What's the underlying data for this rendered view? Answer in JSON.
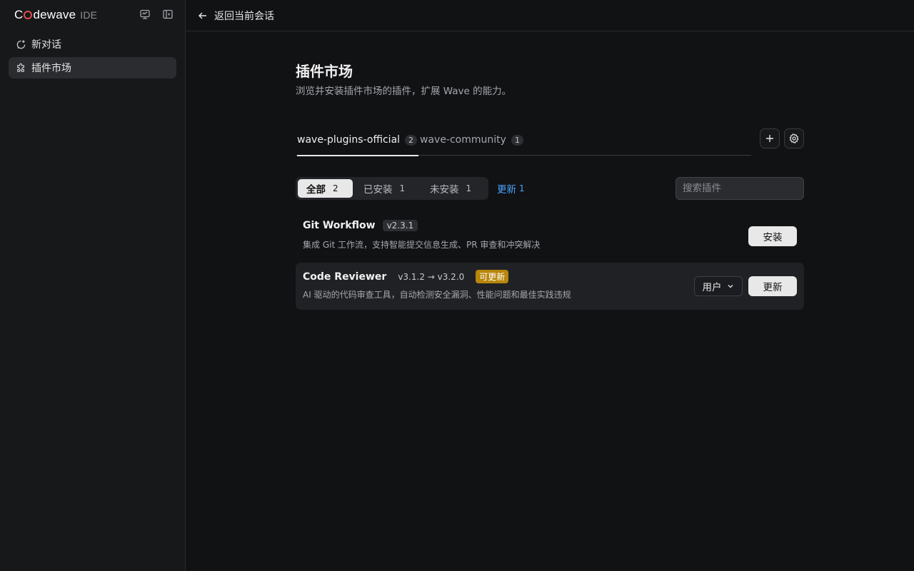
{
  "sidebar": {
    "brand": {
      "prefix": "C",
      "suffix": "dewave",
      "ide": "IDE"
    },
    "items": [
      {
        "label": "新对话",
        "icon": "new-chat-icon"
      },
      {
        "label": "插件市场",
        "icon": "plugin-icon"
      }
    ],
    "icons": {
      "top_left": "monitor-icon",
      "top_right": "collapse-sidebar-icon"
    }
  },
  "topbar": {
    "back_label": "返回当前会话"
  },
  "main": {
    "title": "插件市场",
    "subtitle": "浏览并安装插件市场的插件，扩展 Wave 的能力。",
    "tabs": [
      {
        "label": "wave-plugins-official",
        "count": "2"
      },
      {
        "label": "wave-community",
        "count": "1"
      }
    ],
    "filters": [
      {
        "label": "全部",
        "count": "2"
      },
      {
        "label": "已安装",
        "count": "1"
      },
      {
        "label": "未安装",
        "count": "1"
      }
    ],
    "update_link": {
      "label": "更新",
      "count": "1"
    },
    "search": {
      "placeholder": "搜索插件"
    },
    "plugins": [
      {
        "name": "Git Workflow",
        "version": "v2.3.1",
        "description": "集成 Git 工作流，支持智能提交信息生成、PR 审查和冲突解决",
        "action": "安装"
      },
      {
        "name": "Code Reviewer",
        "version": "v3.1.2 → v3.2.0",
        "badge": "可更新",
        "description": "AI 驱动的代码审查工具，自动检测安全漏洞、性能问题和最佳实践违规",
        "scope": "用户",
        "action": "更新"
      }
    ]
  },
  "colors": {
    "background": "#111214",
    "sidebar": "#16181a",
    "accent_link": "#4aa3ff",
    "update_badge": "#b8860b",
    "brand_o": "#e04e4e"
  }
}
